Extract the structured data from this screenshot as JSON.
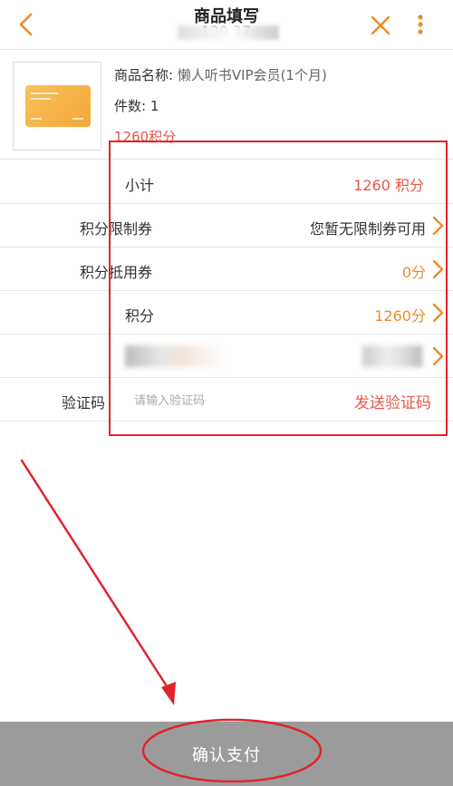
{
  "header": {
    "title": "商品填写",
    "subtitle": "1̶3̶0̶ ̶ ̶ ̶ ̶ ̶ ̶ ̶ ̶3̶7̶"
  },
  "product": {
    "name_label": "商品名称:",
    "name_value": "懒人听书VIP会员(1个月)",
    "count_label": "件数:",
    "count_value": "1",
    "price": "1260积分"
  },
  "rows": {
    "subtotal": {
      "label": "小计",
      "value": "1260 积分"
    },
    "unlimited_coupon": {
      "label": "积分限制券",
      "value": "您暂无限制券可用"
    },
    "deduct_coupon": {
      "label": "积分抵用券",
      "value": "0分"
    },
    "points": {
      "label": "积分",
      "value": "1260分"
    },
    "verify": {
      "label": "验证码",
      "placeholder": "请输入验证码",
      "send_label": "发送验证码"
    }
  },
  "bottom": {
    "confirm_label": "确认支付"
  },
  "colors": {
    "accent_orange": "#f08a2c",
    "price_red": "#e8554a",
    "annotation_red": "#e0242c",
    "bottom_bar": "#9b9b9b"
  },
  "icons": {
    "back": "chevron-left-icon",
    "close": "close-icon",
    "more": "more-vertical-icon",
    "row_arrow": "chevron-right-icon"
  }
}
